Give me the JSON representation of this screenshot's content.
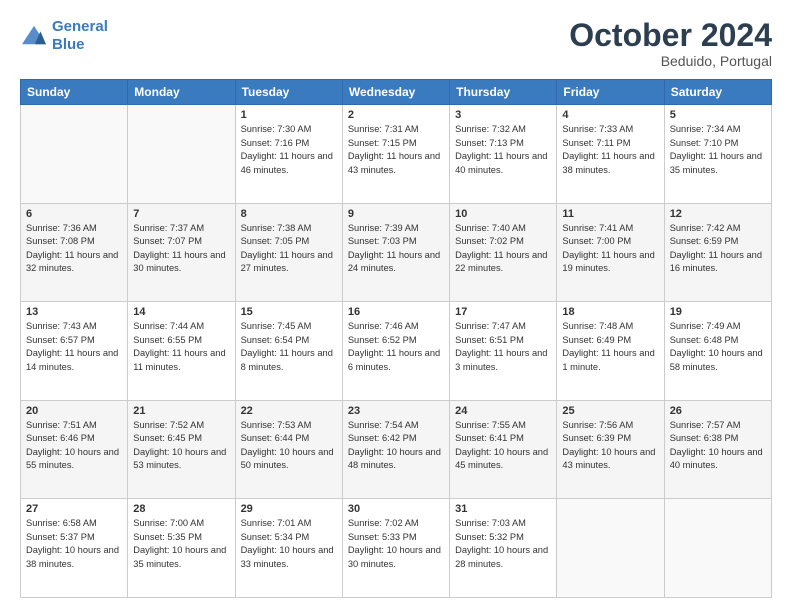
{
  "header": {
    "logo_line1": "General",
    "logo_line2": "Blue",
    "month": "October 2024",
    "location": "Beduido, Portugal"
  },
  "weekdays": [
    "Sunday",
    "Monday",
    "Tuesday",
    "Wednesday",
    "Thursday",
    "Friday",
    "Saturday"
  ],
  "weeks": [
    [
      {
        "day": "",
        "info": ""
      },
      {
        "day": "",
        "info": ""
      },
      {
        "day": "1",
        "info": "Sunrise: 7:30 AM\nSunset: 7:16 PM\nDaylight: 11 hours and 46 minutes."
      },
      {
        "day": "2",
        "info": "Sunrise: 7:31 AM\nSunset: 7:15 PM\nDaylight: 11 hours and 43 minutes."
      },
      {
        "day": "3",
        "info": "Sunrise: 7:32 AM\nSunset: 7:13 PM\nDaylight: 11 hours and 40 minutes."
      },
      {
        "day": "4",
        "info": "Sunrise: 7:33 AM\nSunset: 7:11 PM\nDaylight: 11 hours and 38 minutes."
      },
      {
        "day": "5",
        "info": "Sunrise: 7:34 AM\nSunset: 7:10 PM\nDaylight: 11 hours and 35 minutes."
      }
    ],
    [
      {
        "day": "6",
        "info": "Sunrise: 7:36 AM\nSunset: 7:08 PM\nDaylight: 11 hours and 32 minutes."
      },
      {
        "day": "7",
        "info": "Sunrise: 7:37 AM\nSunset: 7:07 PM\nDaylight: 11 hours and 30 minutes."
      },
      {
        "day": "8",
        "info": "Sunrise: 7:38 AM\nSunset: 7:05 PM\nDaylight: 11 hours and 27 minutes."
      },
      {
        "day": "9",
        "info": "Sunrise: 7:39 AM\nSunset: 7:03 PM\nDaylight: 11 hours and 24 minutes."
      },
      {
        "day": "10",
        "info": "Sunrise: 7:40 AM\nSunset: 7:02 PM\nDaylight: 11 hours and 22 minutes."
      },
      {
        "day": "11",
        "info": "Sunrise: 7:41 AM\nSunset: 7:00 PM\nDaylight: 11 hours and 19 minutes."
      },
      {
        "day": "12",
        "info": "Sunrise: 7:42 AM\nSunset: 6:59 PM\nDaylight: 11 hours and 16 minutes."
      }
    ],
    [
      {
        "day": "13",
        "info": "Sunrise: 7:43 AM\nSunset: 6:57 PM\nDaylight: 11 hours and 14 minutes."
      },
      {
        "day": "14",
        "info": "Sunrise: 7:44 AM\nSunset: 6:55 PM\nDaylight: 11 hours and 11 minutes."
      },
      {
        "day": "15",
        "info": "Sunrise: 7:45 AM\nSunset: 6:54 PM\nDaylight: 11 hours and 8 minutes."
      },
      {
        "day": "16",
        "info": "Sunrise: 7:46 AM\nSunset: 6:52 PM\nDaylight: 11 hours and 6 minutes."
      },
      {
        "day": "17",
        "info": "Sunrise: 7:47 AM\nSunset: 6:51 PM\nDaylight: 11 hours and 3 minutes."
      },
      {
        "day": "18",
        "info": "Sunrise: 7:48 AM\nSunset: 6:49 PM\nDaylight: 11 hours and 1 minute."
      },
      {
        "day": "19",
        "info": "Sunrise: 7:49 AM\nSunset: 6:48 PM\nDaylight: 10 hours and 58 minutes."
      }
    ],
    [
      {
        "day": "20",
        "info": "Sunrise: 7:51 AM\nSunset: 6:46 PM\nDaylight: 10 hours and 55 minutes."
      },
      {
        "day": "21",
        "info": "Sunrise: 7:52 AM\nSunset: 6:45 PM\nDaylight: 10 hours and 53 minutes."
      },
      {
        "day": "22",
        "info": "Sunrise: 7:53 AM\nSunset: 6:44 PM\nDaylight: 10 hours and 50 minutes."
      },
      {
        "day": "23",
        "info": "Sunrise: 7:54 AM\nSunset: 6:42 PM\nDaylight: 10 hours and 48 minutes."
      },
      {
        "day": "24",
        "info": "Sunrise: 7:55 AM\nSunset: 6:41 PM\nDaylight: 10 hours and 45 minutes."
      },
      {
        "day": "25",
        "info": "Sunrise: 7:56 AM\nSunset: 6:39 PM\nDaylight: 10 hours and 43 minutes."
      },
      {
        "day": "26",
        "info": "Sunrise: 7:57 AM\nSunset: 6:38 PM\nDaylight: 10 hours and 40 minutes."
      }
    ],
    [
      {
        "day": "27",
        "info": "Sunrise: 6:58 AM\nSunset: 5:37 PM\nDaylight: 10 hours and 38 minutes."
      },
      {
        "day": "28",
        "info": "Sunrise: 7:00 AM\nSunset: 5:35 PM\nDaylight: 10 hours and 35 minutes."
      },
      {
        "day": "29",
        "info": "Sunrise: 7:01 AM\nSunset: 5:34 PM\nDaylight: 10 hours and 33 minutes."
      },
      {
        "day": "30",
        "info": "Sunrise: 7:02 AM\nSunset: 5:33 PM\nDaylight: 10 hours and 30 minutes."
      },
      {
        "day": "31",
        "info": "Sunrise: 7:03 AM\nSunset: 5:32 PM\nDaylight: 10 hours and 28 minutes."
      },
      {
        "day": "",
        "info": ""
      },
      {
        "day": "",
        "info": ""
      }
    ]
  ]
}
